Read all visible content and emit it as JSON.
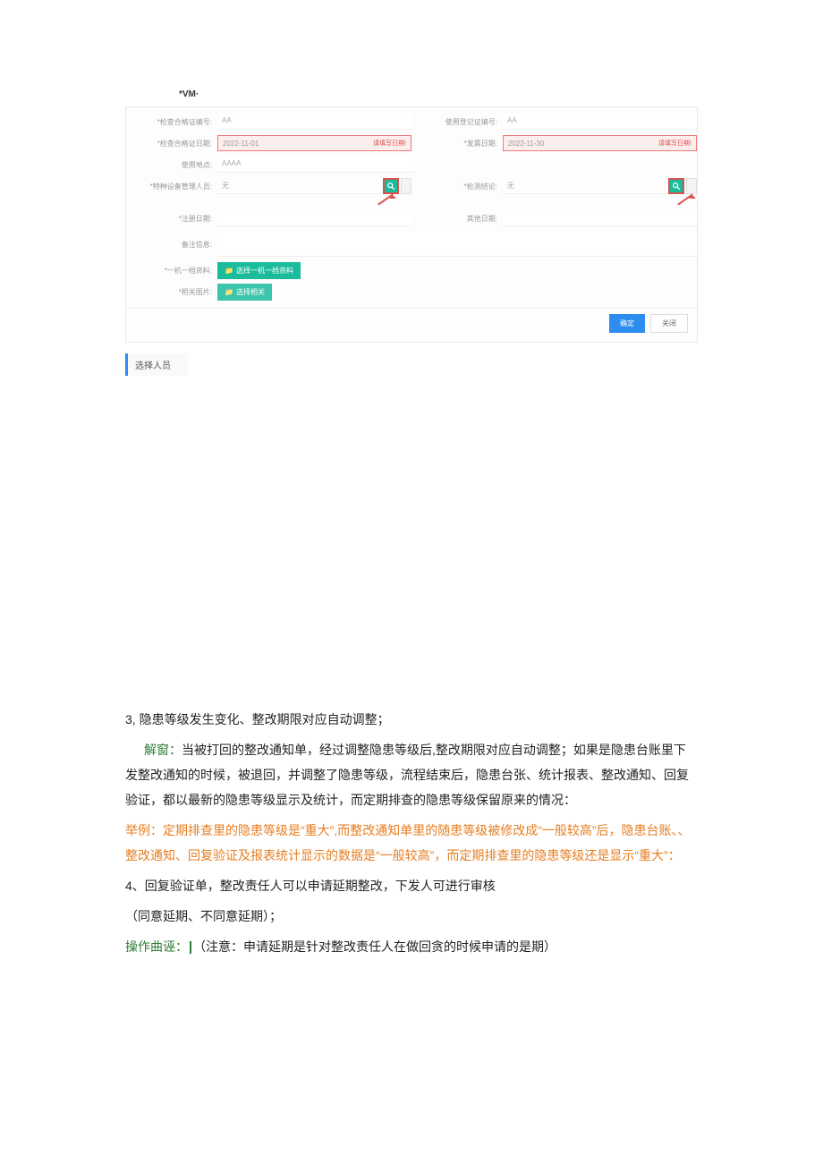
{
  "header": {
    "label": "*VM·"
  },
  "form": {
    "row1": {
      "left": {
        "label": "*检查合格证编号:",
        "value": "AA"
      },
      "right": {
        "label": "使用登记证编号:",
        "value": "AA"
      }
    },
    "row2": {
      "left": {
        "label": "*检查合格证日期:",
        "date": "2022-11-01",
        "warn": "请填写日期!"
      },
      "right": {
        "label": "*发票日期:",
        "date": "2022-11-30",
        "warn": "请填写日期!"
      }
    },
    "row3": {
      "label": "使用地点:",
      "value": "AAAA"
    },
    "row4": {
      "left": {
        "label": "*特种设备管理人员:",
        "value": "无"
      },
      "right": {
        "label": "*检测结论:",
        "value": "无"
      }
    },
    "row5": {
      "left_label": "*注册日期:",
      "right_label": "其他日期:"
    },
    "row6": {
      "label": "备注信息:"
    },
    "upload1": {
      "label": "*一机一档资料:",
      "btn": "选择一机一档资料"
    },
    "upload2": {
      "label": "*相关图片:",
      "btn": "选择相关"
    },
    "footer": {
      "confirm": "确定",
      "cancel": "关闭"
    }
  },
  "tab": {
    "label": "选择人员"
  },
  "doc": {
    "p3_lead": "3,",
    "p3_title": "隐患等级发生变化、整改期限对应自动调整；",
    "p4_label": "解窗：",
    "p4_body": "当被打回的整改通知单，经过调整隐患等级后,整改期限对应自动调整；如果是隐患台账里下发整改通知的时候，被退回，并调整了隐患等级，流程结束后，隐患台张、统计报表、整改通知、回复验证，都以最新的隐患等级显示及统计，而定期排查的隐患等级保留原来的情况：",
    "p5_label": "举例：",
    "p5_body": "定期排查里的隐患等级是“重大”,而整改通知单里的随患等级被修改成“一般较高”后，隐患台账、、整改通知、回复验证及报表统计显示的数据是“一般较高”，而定期排查里的隐患等级还是显示“重大”：",
    "p6_lead": "4、",
    "p6_title": "回复验证单，整改责任人可以申请延期整改，下发人可进行审核",
    "p7": "（同意延期、不同意延期）；",
    "p8_label": "操作曲诬：",
    "p8_body": "（注意：申请延期是针对整改责任人在做回贪的时候申请的是期）"
  }
}
